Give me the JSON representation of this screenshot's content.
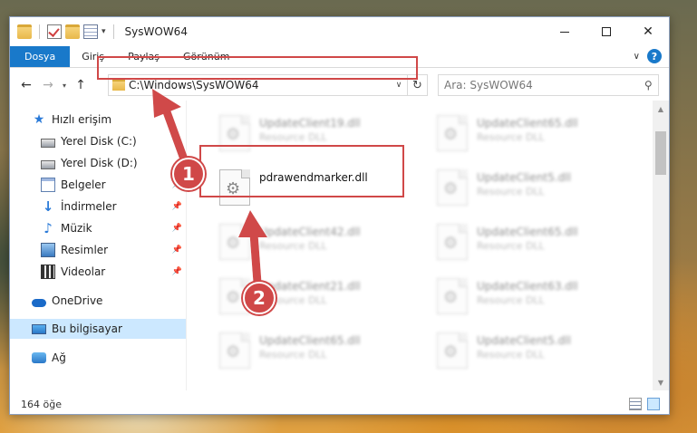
{
  "window": {
    "title": "SysWOW64"
  },
  "ribbon": {
    "tabs": [
      "Dosya",
      "Giriş",
      "Paylaş",
      "Görünüm"
    ],
    "help": "?"
  },
  "navigation": {
    "address": "C:\\Windows\\SysWOW64",
    "search_placeholder": "Ara: SysWOW64"
  },
  "sidebar": {
    "items": [
      {
        "label": "Hızlı erişim",
        "icon": "star-icon"
      },
      {
        "label": "Yerel Disk (C:)",
        "icon": "disk-icon"
      },
      {
        "label": "Yerel Disk (D:)",
        "icon": "disk-icon"
      },
      {
        "label": "Belgeler",
        "icon": "documents-icon"
      },
      {
        "label": "İndirmeler",
        "icon": "download-icon"
      },
      {
        "label": "Müzik",
        "icon": "music-icon"
      },
      {
        "label": "Resimler",
        "icon": "pictures-icon"
      },
      {
        "label": "Videolar",
        "icon": "video-icon"
      },
      {
        "label": "OneDrive",
        "icon": "onedrive-icon"
      },
      {
        "label": "Bu bilgisayar",
        "icon": "computer-icon"
      },
      {
        "label": "Ağ",
        "icon": "network-icon"
      }
    ],
    "selected": "Bu bilgisayar"
  },
  "files": {
    "left": [
      {
        "name": "UpdateClient19.dll",
        "type": "Resource DLL"
      },
      {
        "name": "pdrawendmarker.dll",
        "type": ""
      },
      {
        "name": "UpdateClient42.dll",
        "type": "Resource DLL"
      },
      {
        "name": "UpdateClient21.dll",
        "type": "Resource DLL"
      },
      {
        "name": "UpdateClient65.dll",
        "type": "Resource DLL"
      }
    ],
    "right": [
      {
        "name": "UpdateClient65.dll",
        "type": "Resource DLL"
      },
      {
        "name": "UpdateClient5.dll",
        "type": "Resource DLL"
      },
      {
        "name": "UpdateClient65.dll",
        "type": "Resource DLL"
      },
      {
        "name": "UpdateClient63.dll",
        "type": "Resource DLL"
      },
      {
        "name": "UpdateClient5.dll",
        "type": "Resource DLL"
      }
    ]
  },
  "status": {
    "item_count": "164 öğe"
  },
  "annotations": {
    "step1": "1",
    "step2": "2",
    "color": "#d04848"
  }
}
